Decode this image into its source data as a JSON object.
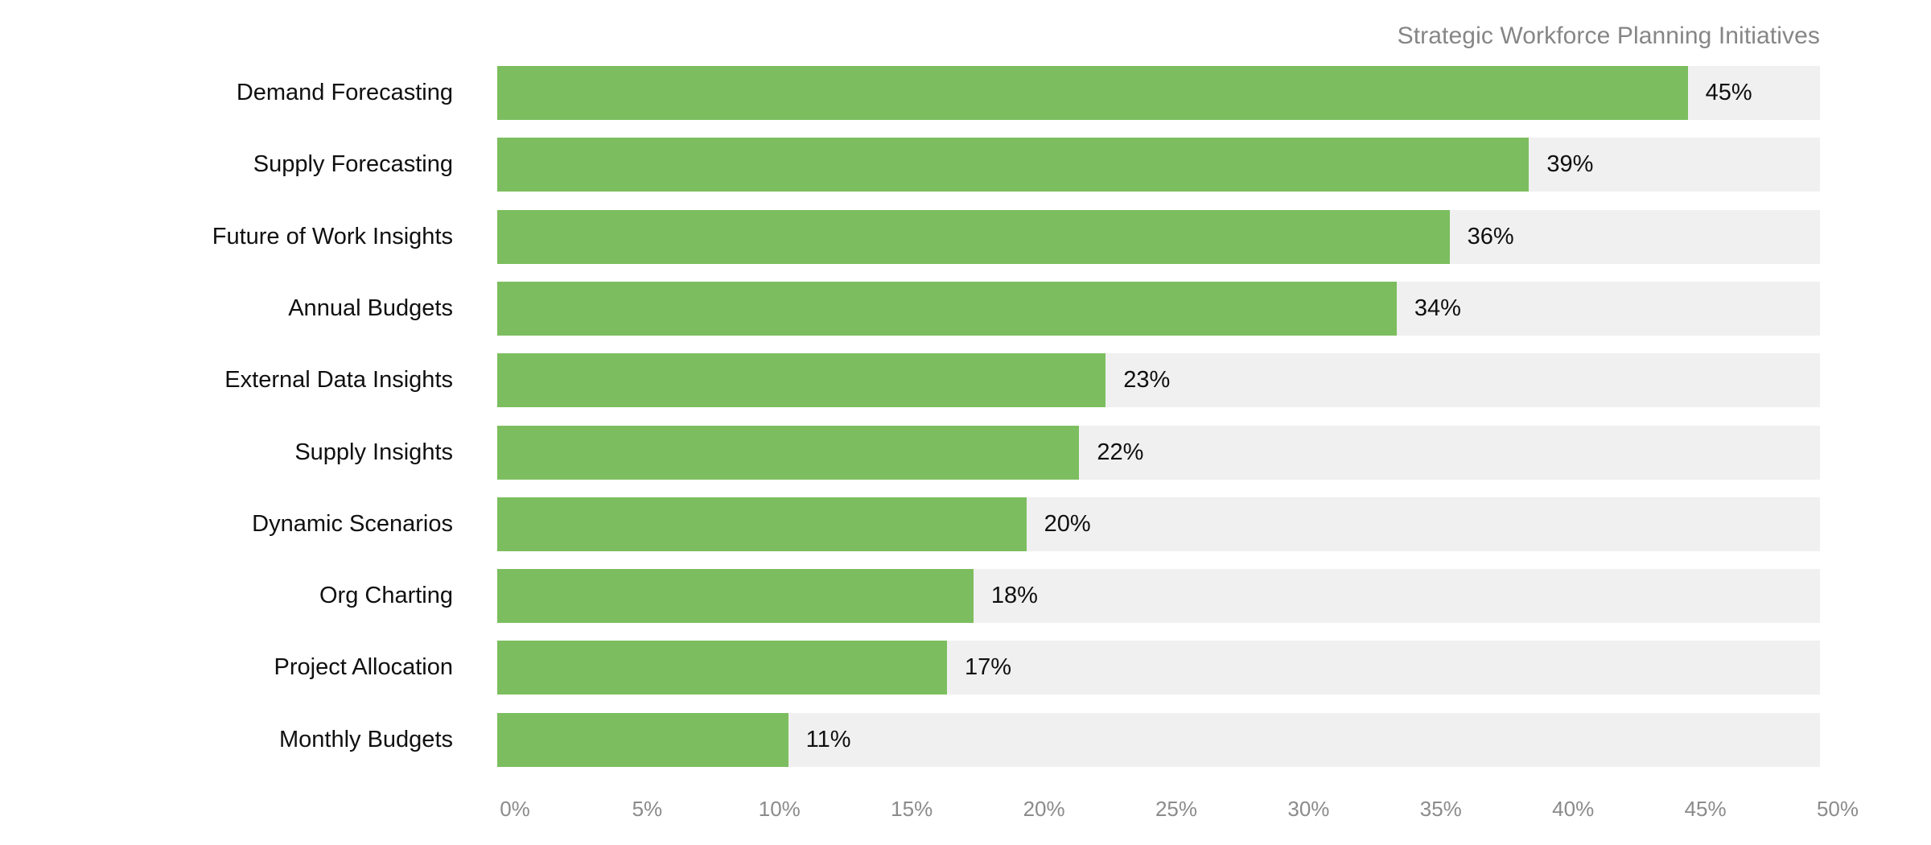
{
  "chart": {
    "title": "Strategic Workforce Planning Initiatives",
    "colors": {
      "bar_fill": "#7cbe5f",
      "track_background": "#f0f0f0",
      "label_text": "#101010",
      "axis_text": "#8b8b8b",
      "title_text": "#868686",
      "page_background": "#ffffff"
    }
  },
  "chart_data": {
    "type": "bar",
    "orientation": "horizontal",
    "title": "Strategic Workforce Planning Initiatives",
    "xlabel": "",
    "ylabel": "",
    "xlim": [
      0,
      50
    ],
    "grid": false,
    "legend": "none",
    "value_suffix": "%",
    "categories": [
      "Demand Forecasting",
      "Supply Forecasting",
      "Future of Work Insights",
      "Annual Budgets",
      "External Data Insights",
      "Supply Insights",
      "Dynamic Scenarios",
      "Org Charting",
      "Project Allocation",
      "Monthly Budgets"
    ],
    "values": [
      45,
      39,
      36,
      34,
      23,
      22,
      20,
      18,
      17,
      11
    ],
    "value_labels": [
      "45%",
      "39%",
      "36%",
      "34%",
      "23%",
      "22%",
      "20%",
      "18%",
      "17%",
      "11%"
    ],
    "xticks": [
      0,
      5,
      10,
      15,
      20,
      25,
      30,
      35,
      40,
      45,
      50
    ],
    "xticklabels": [
      "0%",
      "5%",
      "10%",
      "15%",
      "20%",
      "25%",
      "30%",
      "35%",
      "40%",
      "45%",
      "50%"
    ],
    "bars": [
      {
        "category": "Demand Forecasting",
        "value": 45,
        "label": "45%"
      },
      {
        "category": "Supply Forecasting",
        "value": 39,
        "label": "39%"
      },
      {
        "category": "Future of Work Insights",
        "value": 36,
        "label": "36%"
      },
      {
        "category": "Annual Budgets",
        "value": 34,
        "label": "34%"
      },
      {
        "category": "External Data Insights",
        "value": 23,
        "label": "23%"
      },
      {
        "category": "Supply Insights",
        "value": 22,
        "label": "22%"
      },
      {
        "category": "Dynamic Scenarios",
        "value": 20,
        "label": "20%"
      },
      {
        "category": "Org Charting",
        "value": 18,
        "label": "18%"
      },
      {
        "category": "Project Allocation",
        "value": 17,
        "label": "17%"
      },
      {
        "category": "Monthly Budgets",
        "value": 11,
        "label": "11%"
      }
    ]
  }
}
